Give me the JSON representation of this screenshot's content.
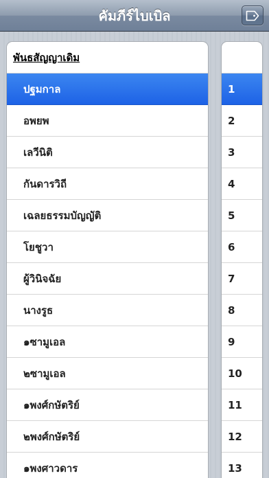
{
  "navbar": {
    "title": "คัมภีร์ไบเบิล",
    "action_icon": "tag-icon"
  },
  "books": {
    "section_title": "พันธสัญญาเดิม",
    "items": [
      "ปฐมกาล",
      "อพยพ",
      "เลวีนิติ",
      "กันดารวิถี",
      "เฉลยธรรมบัญญัติ",
      "โยชูวา",
      "ผู้วินิจฉัย",
      "นางรูธ",
      "๑ซามูเอล",
      "๒ซามูเอล",
      "๑พงศ์กษัตริย์",
      "๒พงศ์กษัตริย์",
      "๑พงศาวดาร"
    ],
    "selected_index": 0
  },
  "chapters": {
    "items": [
      "1",
      "2",
      "3",
      "4",
      "5",
      "6",
      "7",
      "8",
      "9",
      "10",
      "11",
      "12",
      "13"
    ],
    "selected_index": 0
  },
  "colors": {
    "selection": "#1d62e6",
    "navbar": "#7a8aa0",
    "background": "#c5ccd4"
  }
}
